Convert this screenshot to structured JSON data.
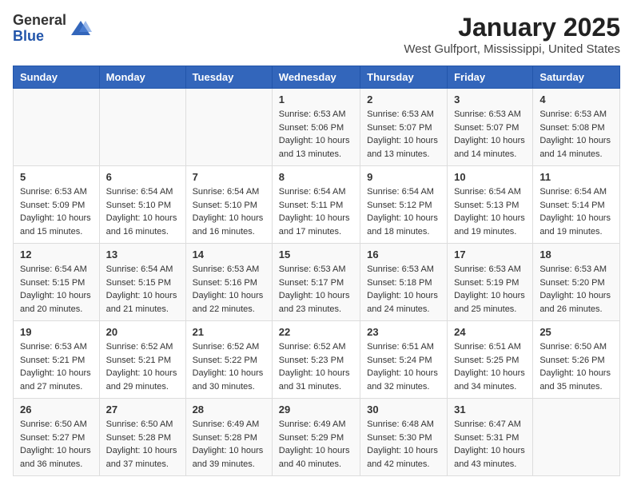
{
  "header": {
    "logo_general": "General",
    "logo_blue": "Blue",
    "month_title": "January 2025",
    "location": "West Gulfport, Mississippi, United States"
  },
  "weekdays": [
    "Sunday",
    "Monday",
    "Tuesday",
    "Wednesday",
    "Thursday",
    "Friday",
    "Saturday"
  ],
  "weeks": [
    [
      {
        "day": "",
        "info": ""
      },
      {
        "day": "",
        "info": ""
      },
      {
        "day": "",
        "info": ""
      },
      {
        "day": "1",
        "info": "Sunrise: 6:53 AM\nSunset: 5:06 PM\nDaylight: 10 hours\nand 13 minutes."
      },
      {
        "day": "2",
        "info": "Sunrise: 6:53 AM\nSunset: 5:07 PM\nDaylight: 10 hours\nand 13 minutes."
      },
      {
        "day": "3",
        "info": "Sunrise: 6:53 AM\nSunset: 5:07 PM\nDaylight: 10 hours\nand 14 minutes."
      },
      {
        "day": "4",
        "info": "Sunrise: 6:53 AM\nSunset: 5:08 PM\nDaylight: 10 hours\nand 14 minutes."
      }
    ],
    [
      {
        "day": "5",
        "info": "Sunrise: 6:53 AM\nSunset: 5:09 PM\nDaylight: 10 hours\nand 15 minutes."
      },
      {
        "day": "6",
        "info": "Sunrise: 6:54 AM\nSunset: 5:10 PM\nDaylight: 10 hours\nand 16 minutes."
      },
      {
        "day": "7",
        "info": "Sunrise: 6:54 AM\nSunset: 5:10 PM\nDaylight: 10 hours\nand 16 minutes."
      },
      {
        "day": "8",
        "info": "Sunrise: 6:54 AM\nSunset: 5:11 PM\nDaylight: 10 hours\nand 17 minutes."
      },
      {
        "day": "9",
        "info": "Sunrise: 6:54 AM\nSunset: 5:12 PM\nDaylight: 10 hours\nand 18 minutes."
      },
      {
        "day": "10",
        "info": "Sunrise: 6:54 AM\nSunset: 5:13 PM\nDaylight: 10 hours\nand 19 minutes."
      },
      {
        "day": "11",
        "info": "Sunrise: 6:54 AM\nSunset: 5:14 PM\nDaylight: 10 hours\nand 19 minutes."
      }
    ],
    [
      {
        "day": "12",
        "info": "Sunrise: 6:54 AM\nSunset: 5:15 PM\nDaylight: 10 hours\nand 20 minutes."
      },
      {
        "day": "13",
        "info": "Sunrise: 6:54 AM\nSunset: 5:15 PM\nDaylight: 10 hours\nand 21 minutes."
      },
      {
        "day": "14",
        "info": "Sunrise: 6:53 AM\nSunset: 5:16 PM\nDaylight: 10 hours\nand 22 minutes."
      },
      {
        "day": "15",
        "info": "Sunrise: 6:53 AM\nSunset: 5:17 PM\nDaylight: 10 hours\nand 23 minutes."
      },
      {
        "day": "16",
        "info": "Sunrise: 6:53 AM\nSunset: 5:18 PM\nDaylight: 10 hours\nand 24 minutes."
      },
      {
        "day": "17",
        "info": "Sunrise: 6:53 AM\nSunset: 5:19 PM\nDaylight: 10 hours\nand 25 minutes."
      },
      {
        "day": "18",
        "info": "Sunrise: 6:53 AM\nSunset: 5:20 PM\nDaylight: 10 hours\nand 26 minutes."
      }
    ],
    [
      {
        "day": "19",
        "info": "Sunrise: 6:53 AM\nSunset: 5:21 PM\nDaylight: 10 hours\nand 27 minutes."
      },
      {
        "day": "20",
        "info": "Sunrise: 6:52 AM\nSunset: 5:21 PM\nDaylight: 10 hours\nand 29 minutes."
      },
      {
        "day": "21",
        "info": "Sunrise: 6:52 AM\nSunset: 5:22 PM\nDaylight: 10 hours\nand 30 minutes."
      },
      {
        "day": "22",
        "info": "Sunrise: 6:52 AM\nSunset: 5:23 PM\nDaylight: 10 hours\nand 31 minutes."
      },
      {
        "day": "23",
        "info": "Sunrise: 6:51 AM\nSunset: 5:24 PM\nDaylight: 10 hours\nand 32 minutes."
      },
      {
        "day": "24",
        "info": "Sunrise: 6:51 AM\nSunset: 5:25 PM\nDaylight: 10 hours\nand 34 minutes."
      },
      {
        "day": "25",
        "info": "Sunrise: 6:50 AM\nSunset: 5:26 PM\nDaylight: 10 hours\nand 35 minutes."
      }
    ],
    [
      {
        "day": "26",
        "info": "Sunrise: 6:50 AM\nSunset: 5:27 PM\nDaylight: 10 hours\nand 36 minutes."
      },
      {
        "day": "27",
        "info": "Sunrise: 6:50 AM\nSunset: 5:28 PM\nDaylight: 10 hours\nand 37 minutes."
      },
      {
        "day": "28",
        "info": "Sunrise: 6:49 AM\nSunset: 5:28 PM\nDaylight: 10 hours\nand 39 minutes."
      },
      {
        "day": "29",
        "info": "Sunrise: 6:49 AM\nSunset: 5:29 PM\nDaylight: 10 hours\nand 40 minutes."
      },
      {
        "day": "30",
        "info": "Sunrise: 6:48 AM\nSunset: 5:30 PM\nDaylight: 10 hours\nand 42 minutes."
      },
      {
        "day": "31",
        "info": "Sunrise: 6:47 AM\nSunset: 5:31 PM\nDaylight: 10 hours\nand 43 minutes."
      },
      {
        "day": "",
        "info": ""
      }
    ]
  ]
}
